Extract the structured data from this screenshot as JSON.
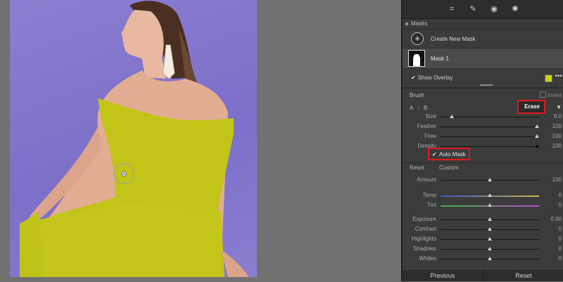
{
  "toolbar": {
    "tools": [
      "crop-icon",
      "healing-icon",
      "red-eye-icon",
      "masking-icon"
    ]
  },
  "masks": {
    "section_title": "Masks",
    "create_label": "Create New Mask",
    "mask_name": "Mask 1",
    "show_overlay_label": "Show Overlay",
    "overlay_color": "#c9d10d",
    "more": "•••"
  },
  "brush": {
    "title": "Brush",
    "invert_label": "Invert",
    "tab_a": "A",
    "tab_b": "B",
    "erase_label": "Erase",
    "dropdown": "▼",
    "sliders": [
      {
        "label": "Size",
        "value": "9.0",
        "level": 0.1
      },
      {
        "label": "Feather",
        "value": "100",
        "level": 1.0
      },
      {
        "label": "Flow",
        "value": "100",
        "level": 1.0
      },
      {
        "label": "Density",
        "value": "100",
        "level": 1.0
      }
    ],
    "auto_mask_label": "Auto Mask",
    "auto_mask_checked": true
  },
  "adjustments": {
    "reset_label": "Reset",
    "preset_label": "Custom",
    "rows": [
      {
        "label": "Amount",
        "value": "100",
        "level": 0.5,
        "track": "plain"
      },
      {
        "label": "Temp",
        "value": "0",
        "level": 0.5,
        "track": "temp"
      },
      {
        "label": "Tint",
        "value": "0",
        "level": 0.5,
        "track": "tint"
      },
      {
        "label": "Exposure",
        "value": "0.00",
        "level": 0.5,
        "track": "plain"
      },
      {
        "label": "Contrast",
        "value": "0",
        "level": 0.5,
        "track": "plain"
      },
      {
        "label": "Highlights",
        "value": "0",
        "level": 0.5,
        "track": "plain"
      },
      {
        "label": "Shadows",
        "value": "0",
        "level": 0.5,
        "track": "plain"
      },
      {
        "label": "Whites",
        "value": "0",
        "level": 0.5,
        "track": "plain"
      }
    ]
  },
  "footer": {
    "previous_label": "Previous",
    "reset_label": "Reset"
  },
  "colors": {
    "highlight_box": "#e3171c",
    "mask_overlay": "#c2c518"
  }
}
